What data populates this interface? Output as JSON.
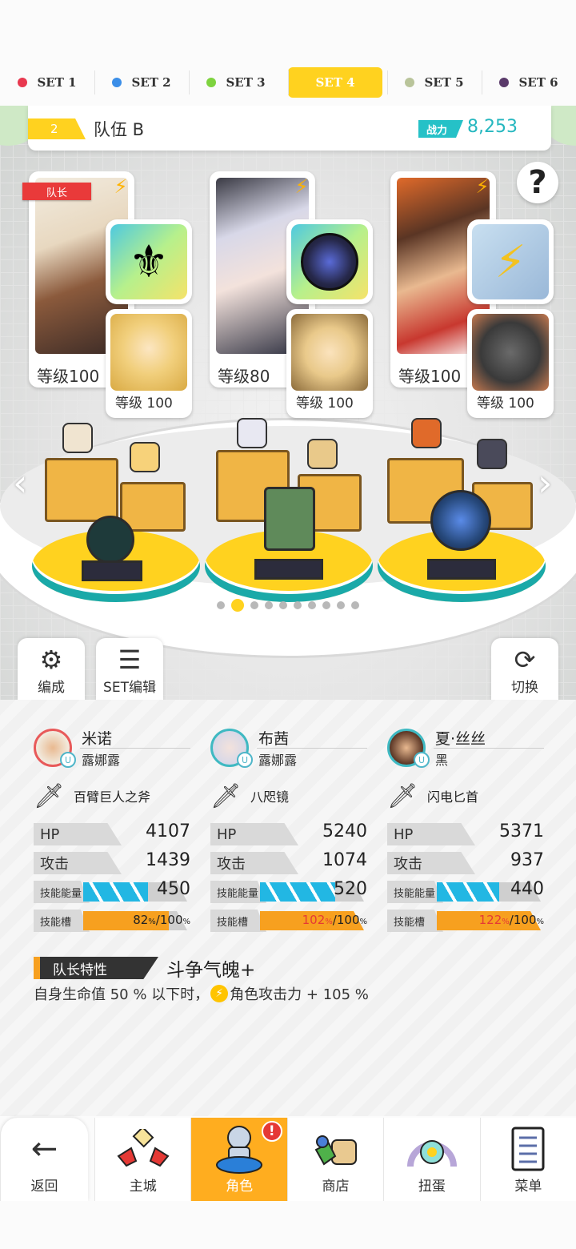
{
  "set_tabs": [
    {
      "label": "SET 1",
      "color": "#e8384f",
      "active": false
    },
    {
      "label": "SET 2",
      "color": "#3b8ee8",
      "active": false
    },
    {
      "label": "SET 3",
      "color": "#7ed33f",
      "active": false
    },
    {
      "label": "SET 4",
      "color": "#ffd21f",
      "active": true
    },
    {
      "label": "SET 5",
      "color": "#b9c49a",
      "active": false
    },
    {
      "label": "SET 6",
      "color": "#5a3a6a",
      "active": false
    }
  ],
  "team": {
    "number": "2",
    "name": "队伍 B",
    "power_label": "战力",
    "power_value": "8,253"
  },
  "help_label": "?",
  "characters": [
    {
      "leader_tag": "队长",
      "level": "等级100",
      "sub_level": "等级 100",
      "weapon_icon": "golden-axe-icon",
      "sub_icon": "blonde-glasses-girl-icon"
    },
    {
      "leader_tag": "",
      "level": "等级80",
      "sub_level": "等级 100",
      "weapon_icon": "dark-mirror-icon",
      "sub_icon": "goggles-girl-icon"
    },
    {
      "leader_tag": "",
      "level": "等级100",
      "sub_level": "等级 100",
      "weapon_icon": "lightning-dagger-icon",
      "sub_icon": "black-cat-icon"
    }
  ],
  "arrows": {
    "left": "‹",
    "right": "›"
  },
  "page_dots": {
    "count": 10,
    "active": 1
  },
  "scene_buttons": {
    "formation": "编成",
    "set_edit": "SET编辑",
    "switch": "切换"
  },
  "stats": [
    {
      "name": "米诺",
      "faction": "露娜露",
      "weapon": "百臂巨人之斧",
      "ring_color": "#e85a5a",
      "hp_label": "HP",
      "hp": "4107",
      "atk_label": "攻击",
      "atk": "1439",
      "energy_label": "技能能量",
      "energy": "450",
      "energy_fill": 0.62,
      "slot_label": "技能槽",
      "slot_pct": "82",
      "slot_pct_unit": "%",
      "slot_max": "/100",
      "slot_max_unit": "%",
      "slot_fill": 0.82,
      "slot_over": false
    },
    {
      "name": "布茜",
      "faction": "露娜露",
      "weapon": "八咫镜",
      "ring_color": "#3fb9c2",
      "hp_label": "HP",
      "hp": "5240",
      "atk_label": "攻击",
      "atk": "1074",
      "energy_label": "技能能量",
      "energy": "520",
      "energy_fill": 0.72,
      "slot_label": "技能槽",
      "slot_pct": "102",
      "slot_pct_unit": "%",
      "slot_max": "/100",
      "slot_max_unit": "%",
      "slot_fill": 1.0,
      "slot_over": true
    },
    {
      "name": "夏·丝丝",
      "faction": "黑",
      "weapon": "闪电匕首",
      "ring_color": "#3fb9c2",
      "hp_label": "HP",
      "hp": "5371",
      "atk_label": "攻击",
      "atk": "937",
      "energy_label": "技能能量",
      "energy": "440",
      "energy_fill": 0.6,
      "slot_label": "技能槽",
      "slot_pct": "122",
      "slot_pct_unit": "%",
      "slot_max": "/100",
      "slot_max_unit": "%",
      "slot_fill": 1.0,
      "slot_over": true
    }
  ],
  "leader_trait": {
    "label": "队长特性",
    "name": "斗争气魄+",
    "desc_before": "自身生命值 50 % 以下时，",
    "desc_icon": "⚡",
    "desc_after": "角色攻击力 + 105 %"
  },
  "nav": {
    "back": "返回",
    "town": "主城",
    "character": "角色",
    "character_badge": "!",
    "shop": "商店",
    "gacha": "扭蛋",
    "menu": "菜单"
  }
}
